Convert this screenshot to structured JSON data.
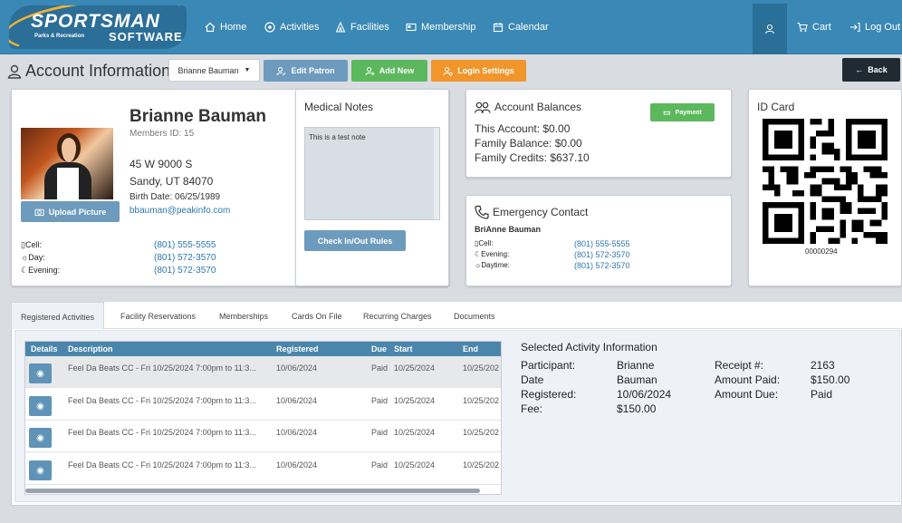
{
  "nav": {
    "logo_main": "SPORTSMAN",
    "logo_sub": "Parks & Recreation",
    "logo_soft": "SOFTWARE",
    "items": [
      "Home",
      "Activities",
      "Facilities",
      "Membership",
      "Calendar"
    ],
    "cart": "Cart",
    "logout": "Log Out"
  },
  "header": {
    "title": "Account Information",
    "patron_select": "Brianne Bauman",
    "edit_patron": "Edit Patron",
    "add_new": "Add New",
    "login_settings": "Login Settings",
    "back": "Back"
  },
  "patron": {
    "name": "Brianne Bauman",
    "member_id": "Members ID: 15",
    "address1": "45 W 9000 S",
    "address2": "Sandy, UT 84070",
    "birth": "Birth Date: 06/25/1989",
    "email": "bbauman@peakinfo.com",
    "upload": "Upload Picture",
    "cell_label": "Cell:",
    "cell": "(801) 555-5555",
    "day_label": "Day:",
    "day": "(801) 572-3570",
    "evening_label": "Evening:",
    "evening": "(801) 572-3570"
  },
  "medical": {
    "title": "Medical Notes",
    "note": "This is a test note",
    "checkin": "Check In/Out Rules"
  },
  "balances": {
    "title": "Account Balances",
    "payment": "Payment",
    "account": "This Account: $0.00",
    "family": "Family Balance: $0.00",
    "credits": "Family Credits: $637.10"
  },
  "emergency": {
    "title": "Emergency Contact",
    "name": "BriAnne Bauman",
    "cell_label": "Cell:",
    "cell": "(801) 555-5555",
    "evening_label": "Evening:",
    "evening": "(801) 572-3570",
    "daytime_label": "Daytime:",
    "daytime": "(801) 572-3570"
  },
  "idcard": {
    "title": "ID Card",
    "number": "00000294"
  },
  "tabs": [
    "Registered Activities",
    "Facility Reservations",
    "Memberships",
    "Cards On File",
    "Recurring Charges",
    "Documents"
  ],
  "table": {
    "headers": [
      "Details",
      "Description",
      "Registered",
      "Due",
      "Start",
      "End"
    ],
    "rows": [
      {
        "description": "Feel Da Beats CC - Fri 10/25/2024 7:00pm to 11:3...",
        "registered": "10/06/2024",
        "due": "Paid",
        "start": "10/25/2024",
        "end": "10/25/202"
      },
      {
        "description": "Feel Da Beats CC - Fri 10/25/2024 7:00pm to 11:3...",
        "registered": "10/06/2024",
        "due": "Paid",
        "start": "10/25/2024",
        "end": "10/25/202"
      },
      {
        "description": "Feel Da Beats CC - Fri 10/25/2024 7:00pm to 11:3...",
        "registered": "10/06/2024",
        "due": "Paid",
        "start": "10/25/2024",
        "end": "10/25/202"
      },
      {
        "description": "Feel Da Beats CC - Fri 10/25/2024 7:00pm to 11:3...",
        "registered": "10/06/2024",
        "due": "Paid",
        "start": "10/25/2024",
        "end": "10/25/202"
      }
    ]
  },
  "selected": {
    "title": "Selected Activity Information",
    "participant_label": "Participant:",
    "participant": "Brianne",
    "date_label": "Date",
    "date_value": "Bauman",
    "registered_label": "Registered:",
    "registered": "10/06/2024",
    "fee_label": "Fee:",
    "fee": "$150.00",
    "receipt_label": "Receipt #:",
    "receipt": "2163",
    "paid_label": "Amount Paid:",
    "paid": "$150.00",
    "due_label": "Amount Due:",
    "due": "Paid"
  },
  "colors": {
    "nav": "#3a88b5",
    "edit": "#6c9bbd",
    "add": "#5cb85c",
    "login": "#f0962a",
    "back": "#1f2a33",
    "link": "#2d78b0"
  }
}
